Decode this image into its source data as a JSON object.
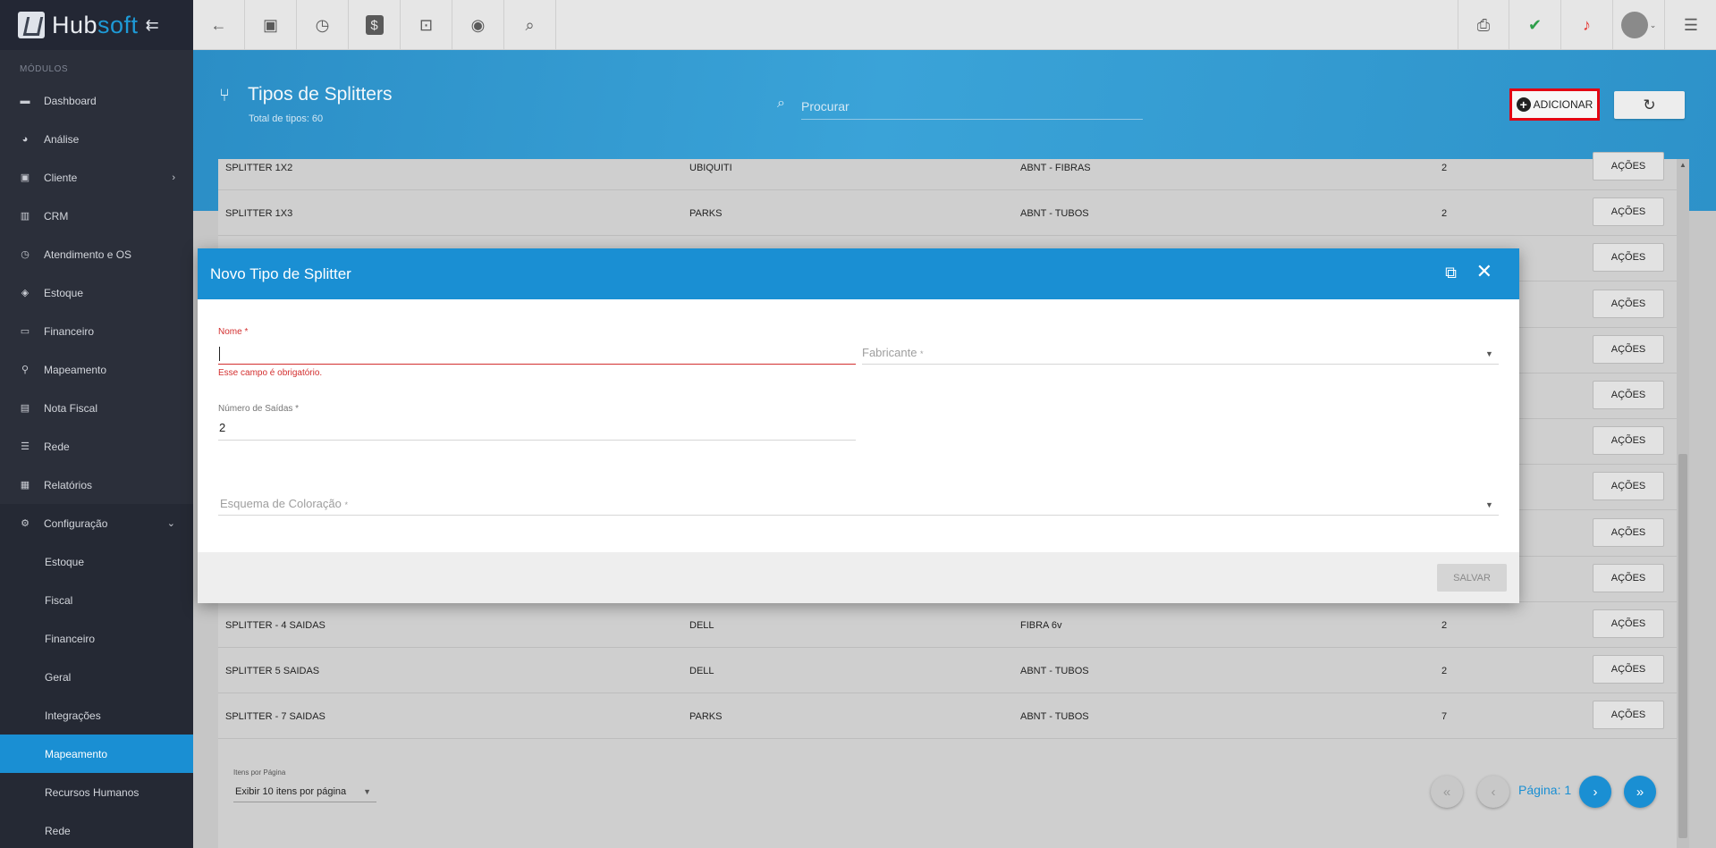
{
  "app": {
    "brand_prefix": "Hub",
    "brand_suffix": "soft",
    "collapse_icon": "arrow-collapse-icon"
  },
  "sidebar": {
    "section_label": "MÓDULOS",
    "items": [
      {
        "label": "Dashboard",
        "icon": "dashboard-icon"
      },
      {
        "label": "Análise",
        "icon": "pie-chart-icon"
      },
      {
        "label": "Cliente",
        "icon": "contact-card-icon"
      },
      {
        "label": "CRM",
        "icon": "kanban-icon"
      },
      {
        "label": "Atendimento e OS",
        "icon": "calendar-clock-icon"
      },
      {
        "label": "Estoque",
        "icon": "cube-icon"
      },
      {
        "label": "Financeiro",
        "icon": "money-icon"
      },
      {
        "label": "Mapeamento",
        "icon": "map-pin-icon"
      },
      {
        "label": "Nota Fiscal",
        "icon": "receipt-icon"
      },
      {
        "label": "Rede",
        "icon": "server-icon"
      },
      {
        "label": "Relatórios",
        "icon": "report-icon"
      },
      {
        "label": "Configuração",
        "icon": "gear-icon"
      }
    ],
    "sub_items": [
      {
        "label": "Estoque"
      },
      {
        "label": "Fiscal"
      },
      {
        "label": "Financeiro"
      },
      {
        "label": "Geral"
      },
      {
        "label": "Integrações"
      },
      {
        "label": "Mapeamento",
        "active": true
      },
      {
        "label": "Recursos Humanos"
      },
      {
        "label": "Rede"
      }
    ]
  },
  "topbar": {
    "left_icons": [
      "back-arrow-icon",
      "contact-icon",
      "calendar-clock-icon",
      "dollar-icon",
      "terminal-icon",
      "eye-icon",
      "search-icon"
    ],
    "right_icons": [
      "pdf-icon",
      "chat-check-icon",
      "alarm-bell-icon",
      "user-avatar-icon",
      "menu-list-icon"
    ]
  },
  "header": {
    "title": "Tipos de Splitters",
    "subtitle": "Total de tipos: 60",
    "search_placeholder": "Procurar",
    "add_label": "ADICIONAR",
    "colors": {
      "accent": "#1a8fd3",
      "highlight_border": "#e30613"
    }
  },
  "table": {
    "action_label": "AÇÕES",
    "rows": [
      {
        "nome": "SPLITTER 1X2",
        "fabricante": "UBIQUITI",
        "esquema": "ABNT - FIBRAS",
        "saidas": "2"
      },
      {
        "nome": "SPLITTER 1X3",
        "fabricante": "PARKS",
        "esquema": "ABNT - TUBOS",
        "saidas": "2"
      },
      {
        "nome": "",
        "fabricante": "",
        "esquema": "",
        "saidas": ""
      },
      {
        "nome": "",
        "fabricante": "",
        "esquema": "",
        "saidas": ""
      },
      {
        "nome": "",
        "fabricante": "",
        "esquema": "",
        "saidas": ""
      },
      {
        "nome": "",
        "fabricante": "",
        "esquema": "",
        "saidas": ""
      },
      {
        "nome": "",
        "fabricante": "",
        "esquema": "",
        "saidas": ""
      },
      {
        "nome": "",
        "fabricante": "",
        "esquema": "",
        "saidas": ""
      },
      {
        "nome": "",
        "fabricante": "",
        "esquema": "",
        "saidas": ""
      },
      {
        "nome": "",
        "fabricante": "",
        "esquema": "",
        "saidas": ""
      },
      {
        "nome": "SPLITTER - 4 SAIDAS",
        "fabricante": "DELL",
        "esquema": "FIBRA 6v",
        "saidas": "2"
      },
      {
        "nome": "SPLITTER 5 SAIDAS",
        "fabricante": "DELL",
        "esquema": "ABNT - TUBOS",
        "saidas": "2"
      },
      {
        "nome": "SPLITTER - 7 SAIDAS",
        "fabricante": "PARKS",
        "esquema": "ABNT - TUBOS",
        "saidas": "7"
      }
    ]
  },
  "pagination": {
    "per_page_label": "Itens por Página",
    "per_page_value": "Exibir 10 itens por página",
    "page_text": "Página: 1"
  },
  "modal": {
    "title": "Novo Tipo de Splitter",
    "nome_label": "Nome",
    "required_mark": "*",
    "nome_error": "Esse campo é obrigatório.",
    "fabricante_placeholder": "Fabricante",
    "saidas_label": "Número de Saídas",
    "saidas_value": "2",
    "esquema_placeholder": "Esquema de Coloração",
    "save_label": "SALVAR"
  }
}
